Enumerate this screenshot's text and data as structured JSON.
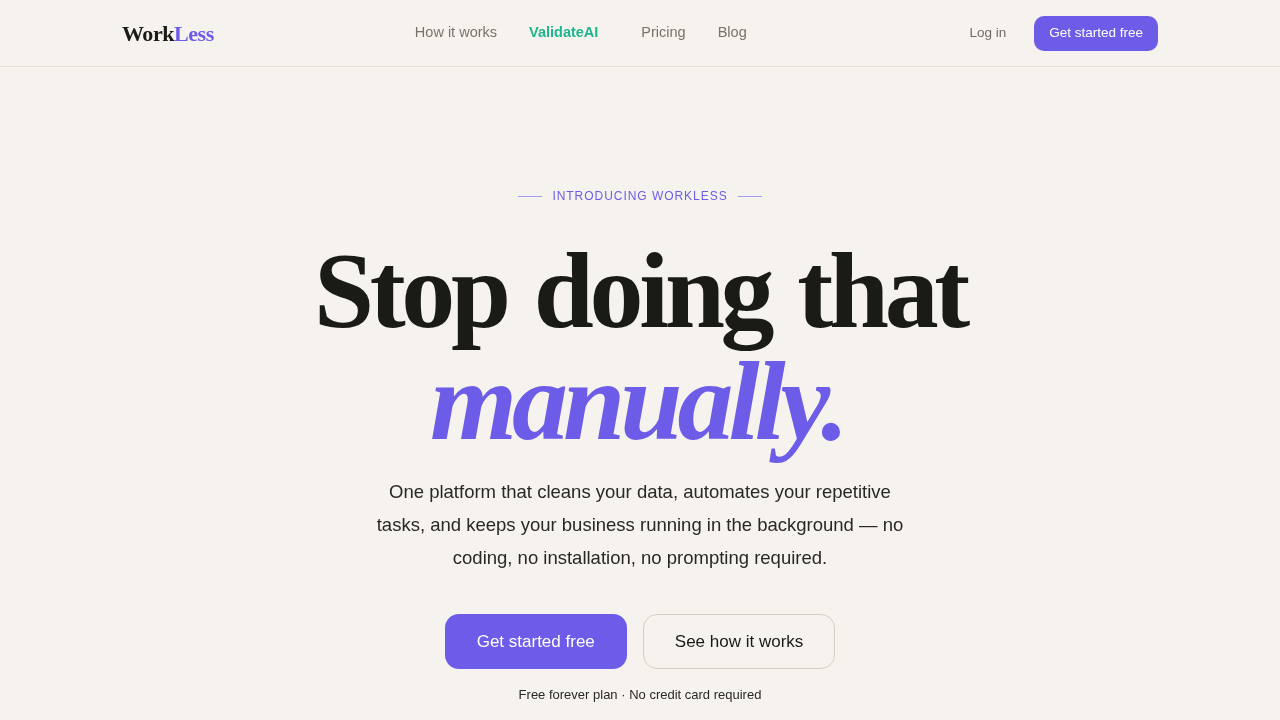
{
  "header": {
    "logo": {
      "text": "Work",
      "accent": "Less"
    },
    "nav": [
      {
        "label": "How it works",
        "highlighted": false
      },
      {
        "label": "ValidateAI",
        "highlighted": true
      },
      {
        "label": "Pricing",
        "highlighted": false
      },
      {
        "label": "Blog",
        "highlighted": false
      }
    ],
    "login": "Log in",
    "cta": "Get started free"
  },
  "hero": {
    "eyebrow": "INTRODUCING WORKLESS",
    "headline": "Stop doing that",
    "headline_emphasis": "manually.",
    "description": "One platform that cleans your data, automates your repetitive tasks, and keeps your business running in the background — no coding, no installation, no prompting required.",
    "buttons": [
      {
        "label": "Get started free",
        "kind": "primary"
      },
      {
        "label": "See how it works",
        "kind": "secondary"
      }
    ],
    "note": "Free forever plan · No credit card required"
  }
}
